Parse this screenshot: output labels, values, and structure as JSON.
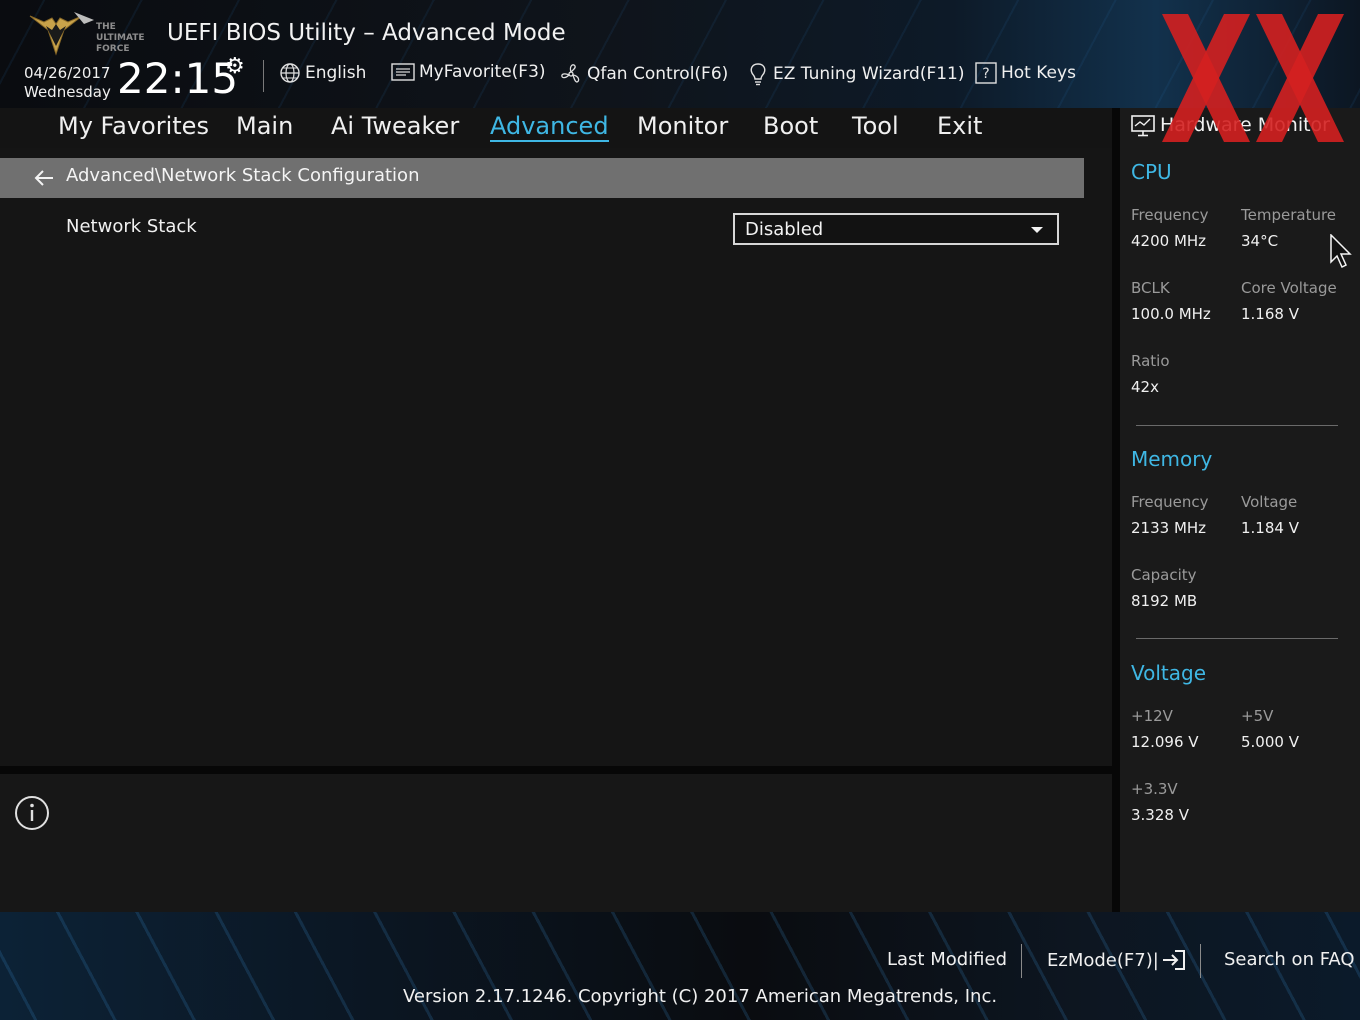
{
  "header": {
    "title": "UEFI BIOS Utility – Advanced Mode",
    "logo_text": "THE ULTIMATE FORCE",
    "date": "04/26/2017",
    "weekday": "Wednesday",
    "time": "22:15",
    "tools": {
      "language": "English",
      "favorite": "MyFavorite(F3)",
      "qfan": "Qfan Control(F6)",
      "ez_tuning": "EZ Tuning Wizard(F11)",
      "hotkeys": "Hot Keys"
    }
  },
  "menu": {
    "items": [
      "My Favorites",
      "Main",
      "Ai Tweaker",
      "Advanced",
      "Monitor",
      "Boot",
      "Tool",
      "Exit"
    ],
    "active": "Advanced"
  },
  "breadcrumb": "Advanced\\Network Stack Configuration",
  "settings": [
    {
      "label": "Network Stack",
      "value": "Disabled"
    }
  ],
  "hardware_monitor": {
    "title": "Hardware Monitor",
    "cpu": {
      "heading": "CPU",
      "frequency_label": "Frequency",
      "frequency": "4200 MHz",
      "temperature_label": "Temperature",
      "temperature": "34°C",
      "bclk_label": "BCLK",
      "bclk": "100.0 MHz",
      "core_voltage_label": "Core Voltage",
      "core_voltage": "1.168 V",
      "ratio_label": "Ratio",
      "ratio": "42x"
    },
    "memory": {
      "heading": "Memory",
      "frequency_label": "Frequency",
      "frequency": "2133 MHz",
      "voltage_label": "Voltage",
      "voltage": "1.184 V",
      "capacity_label": "Capacity",
      "capacity": "8192 MB"
    },
    "voltage": {
      "heading": "Voltage",
      "v12_label": "+12V",
      "v12": "12.096 V",
      "v5_label": "+5V",
      "v5": "5.000 V",
      "v33_label": "+3.3V",
      "v33": "3.328 V"
    }
  },
  "footer": {
    "last_modified": "Last Modified",
    "ezmode": "EzMode(F7)|",
    "search_faq": "Search on FAQ",
    "version": "Version 2.17.1246. Copyright (C) 2017 American Megatrends, Inc."
  },
  "colors": {
    "accent": "#3fb7e4",
    "watermark": "#d42020",
    "breadcrumb_bar": "#707070"
  }
}
